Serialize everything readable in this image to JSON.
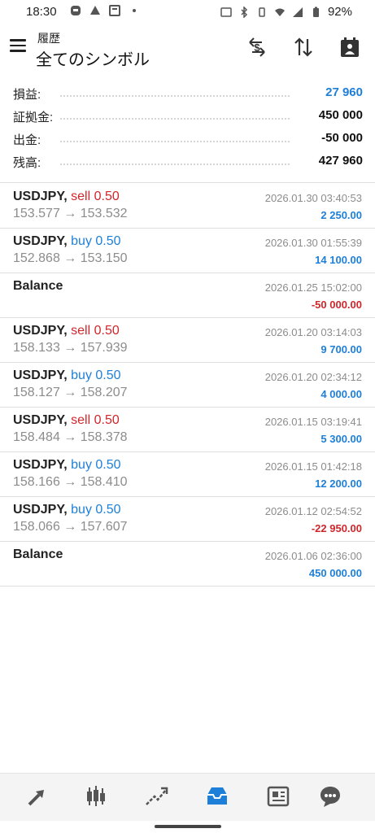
{
  "status": {
    "time": "18:30",
    "battery": "92%"
  },
  "header": {
    "subtitle": "履歴",
    "title": "全てのシンボル"
  },
  "summary": [
    {
      "label": "損益:",
      "value": "27 960",
      "highlight": true
    },
    {
      "label": "証拠金:",
      "value": "450 000",
      "highlight": false
    },
    {
      "label": "出金:",
      "value": "-50 000",
      "highlight": false
    },
    {
      "label": "残高:",
      "value": "427 960",
      "highlight": false
    }
  ],
  "trades": [
    {
      "symbol": "USDJPY,",
      "side": "sell 0.50",
      "side_type": "sell",
      "prices": "153.577 → 153.532",
      "time": "2026.01.30 03:40:53",
      "profit": "2 250.00",
      "profit_sign": "pos"
    },
    {
      "symbol": "USDJPY,",
      "side": "buy 0.50",
      "side_type": "buy",
      "prices": "152.868 → 153.150",
      "time": "2026.01.30 01:55:39",
      "profit": "14 100.00",
      "profit_sign": "pos"
    },
    {
      "symbol": "Balance",
      "side": "",
      "side_type": "",
      "prices": "",
      "time": "2026.01.25 15:02:00",
      "profit": "-50 000.00",
      "profit_sign": "neg"
    },
    {
      "symbol": "USDJPY,",
      "side": "sell 0.50",
      "side_type": "sell",
      "prices": "158.133 → 157.939",
      "time": "2026.01.20 03:14:03",
      "profit": "9 700.00",
      "profit_sign": "pos"
    },
    {
      "symbol": "USDJPY,",
      "side": "buy 0.50",
      "side_type": "buy",
      "prices": "158.127 → 158.207",
      "time": "2026.01.20 02:34:12",
      "profit": "4 000.00",
      "profit_sign": "pos"
    },
    {
      "symbol": "USDJPY,",
      "side": "sell 0.50",
      "side_type": "sell",
      "prices": "158.484 → 158.378",
      "time": "2026.01.15 03:19:41",
      "profit": "5 300.00",
      "profit_sign": "pos"
    },
    {
      "symbol": "USDJPY,",
      "side": "buy 0.50",
      "side_type": "buy",
      "prices": "158.166 → 158.410",
      "time": "2026.01.15 01:42:18",
      "profit": "12 200.00",
      "profit_sign": "pos"
    },
    {
      "symbol": "USDJPY,",
      "side": "buy 0.50",
      "side_type": "buy",
      "prices": "158.066 → 157.607",
      "time": "2026.01.12 02:54:52",
      "profit": "-22 950.00",
      "profit_sign": "neg"
    },
    {
      "symbol": "Balance",
      "side": "",
      "side_type": "",
      "prices": "",
      "time": "2026.01.06 02:36:00",
      "profit": "450 000.00",
      "profit_sign": "pos"
    }
  ],
  "nav": {
    "icons": [
      "quotes-icon",
      "chart-candles-icon",
      "trade-icon",
      "history-icon",
      "news-icon",
      "chat-icon"
    ],
    "active": "history-icon",
    "active_color": "#1e7fd8",
    "inactive_color": "#555555"
  },
  "colors": {
    "buy": "#1e7fd8",
    "sell": "#d0262b"
  }
}
